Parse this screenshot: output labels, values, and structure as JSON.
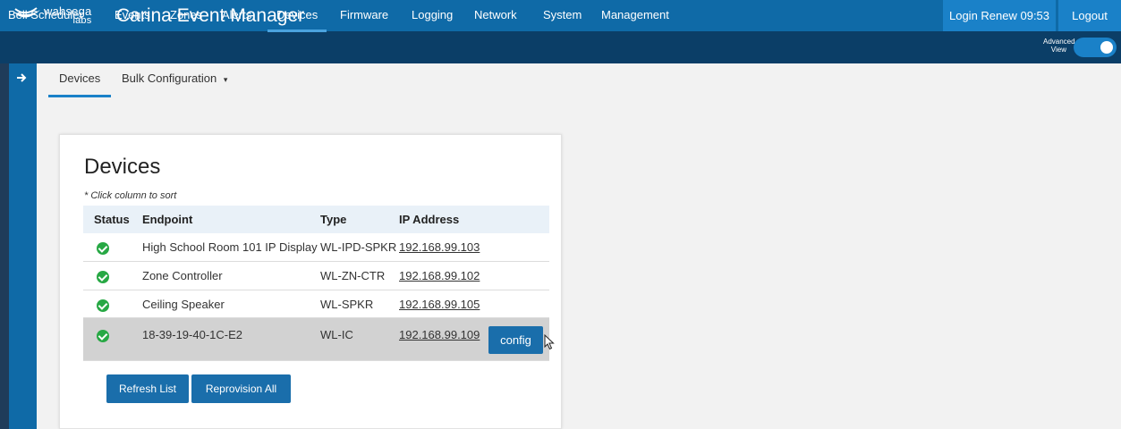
{
  "header": {
    "logo_line1": "wahsega",
    "logo_line2": "labs",
    "title": "Carina Event Manager",
    "login_renew": "Login Renew 09:53",
    "logout": "Logout"
  },
  "nav": {
    "items": [
      "Bell Scheduler",
      "Events",
      "Zones",
      "Alerts",
      "Devices",
      "Firmware",
      "Logging",
      "Network",
      "System",
      "Management"
    ],
    "active": "Devices",
    "advanced_view_line1": "Advanced",
    "advanced_view_line2": "View",
    "advanced_view_on": true
  },
  "sidebar": {
    "toggle_icon": "arrow-right-icon"
  },
  "subnav": {
    "devices": "Devices",
    "bulk_configuration": "Bulk Configuration",
    "bulk_caret": "▾"
  },
  "devices": {
    "title": "Devices",
    "sort_hint": "* Click column to sort",
    "columns": {
      "status": "Status",
      "endpoint": "Endpoint",
      "type": "Type",
      "ip": "IP Address"
    },
    "rows": [
      {
        "endpoint": "High School Room 101 IP Display",
        "type": "WL-IPD-SPKR",
        "ip": "192.168.99.103",
        "status": "ok"
      },
      {
        "endpoint": "Zone Controller",
        "type": "WL-ZN-CTR",
        "ip": "192.168.99.102",
        "status": "ok"
      },
      {
        "endpoint": "Ceiling Speaker",
        "type": "WL-SPKR",
        "ip": "192.168.99.105",
        "status": "ok"
      },
      {
        "endpoint": "18-39-19-40-1C-E2",
        "type": "WL-IC",
        "ip": "192.168.99.109",
        "status": "ok"
      }
    ],
    "config_button": "config",
    "refresh_button": "Refresh List",
    "reprovision_button": "Reprovision All"
  },
  "colors": {
    "topbar": "#0f6aa7",
    "navbar": "#0b3e67",
    "accent": "#1a81c8",
    "status_ok": "#27a844"
  }
}
